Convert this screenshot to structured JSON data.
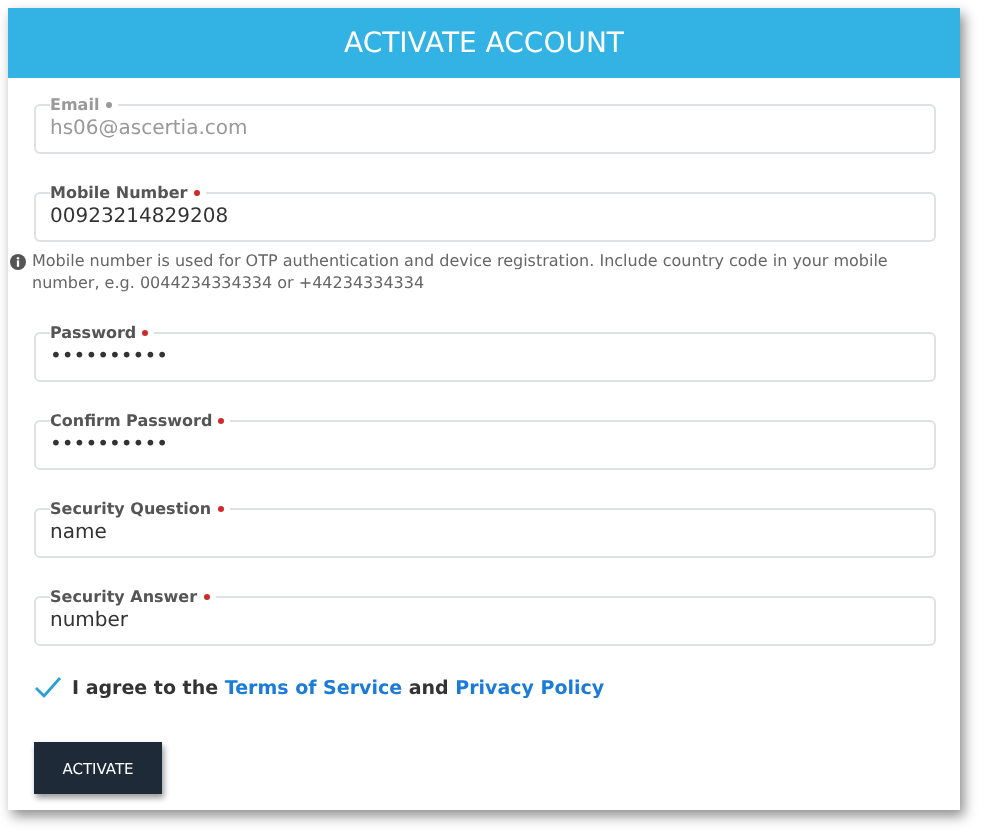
{
  "header": {
    "title": "ACTIVATE ACCOUNT"
  },
  "fields": [
    {
      "label": "Email",
      "required": true,
      "value": "hs06@ascertia.com",
      "disabled": true
    },
    {
      "label": "Mobile Number",
      "required": true,
      "value": "00923214829208",
      "disabled": false,
      "hint": "Mobile number is used for OTP authentication and device registration. Include country code in your mobile number, e.g. 0044234334334 or +44234334334"
    },
    {
      "label": "Password",
      "required": true,
      "value": "••••••••••",
      "disabled": false
    },
    {
      "label": "Confirm Password",
      "required": true,
      "value": "••••••••••",
      "disabled": false
    },
    {
      "label": "Security Question",
      "required": true,
      "value": "name",
      "disabled": false
    },
    {
      "label": "Security Answer",
      "required": true,
      "value": "number",
      "disabled": false
    }
  ],
  "agreement": {
    "checked": true,
    "text": "I agree to the",
    "terms_link": "Terms of Service",
    "joiner": "and",
    "privacy_link": "Privacy Policy"
  },
  "buttons": [
    "ACTIVATE"
  ]
}
